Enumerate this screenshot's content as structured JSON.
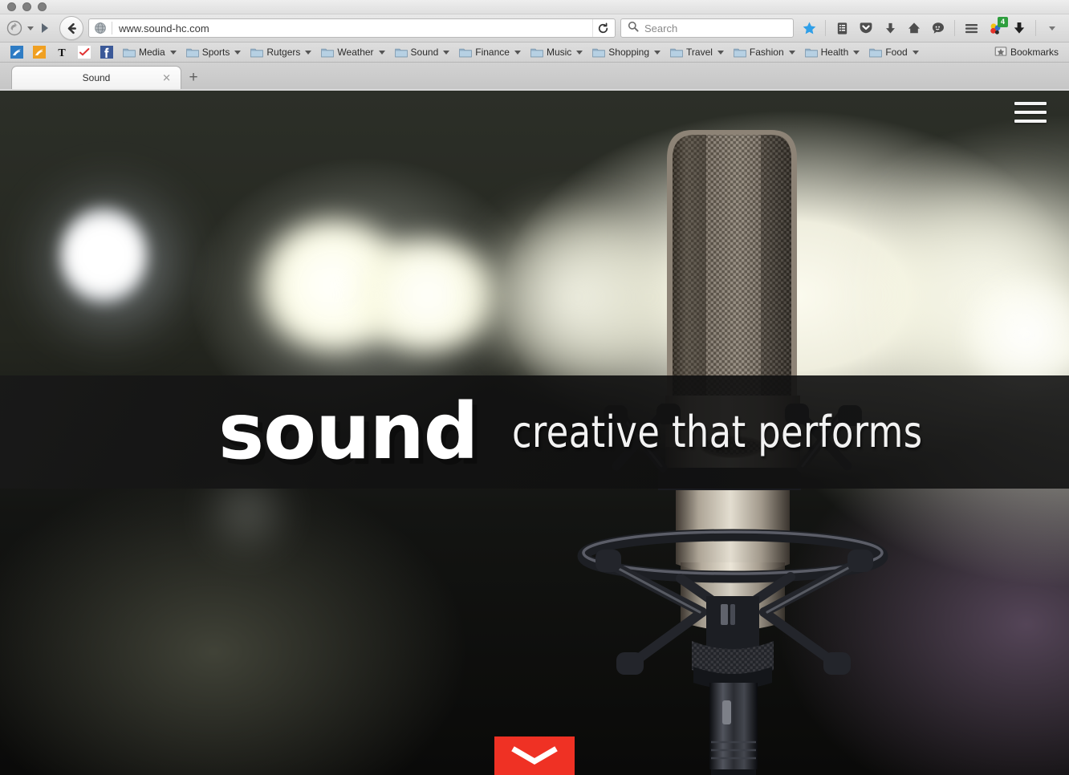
{
  "window": {
    "traffic_lights": [
      "close",
      "minimize",
      "zoom"
    ]
  },
  "toolbar": {
    "firefox_menu_label": "firefox-logo",
    "back_label": "Back",
    "forward_label": "Forward",
    "url": "www.sound-hc.com",
    "reload_label": "Reload",
    "search_placeholder": "Search",
    "icons": [
      {
        "name": "bookmark-star-icon",
        "label": "Bookmark this page"
      },
      {
        "name": "reader-list-icon",
        "label": "Reading list"
      },
      {
        "name": "pocket-icon",
        "label": "Pocket"
      },
      {
        "name": "downloads-icon",
        "label": "Downloads"
      },
      {
        "name": "home-icon",
        "label": "Home"
      },
      {
        "name": "chat-icon",
        "label": "Hello"
      },
      {
        "name": "menu-hamburger-icon",
        "label": "Open menu"
      },
      {
        "name": "extension-icon",
        "label": "Extension",
        "badge": "4"
      },
      {
        "name": "download-manager-icon",
        "label": "Download manager"
      },
      {
        "name": "overflow-caret-icon",
        "label": "More"
      }
    ],
    "extension_badge": "4"
  },
  "bookmarks_bar": {
    "items": [
      {
        "label": "",
        "icon": "site-favicon-blue",
        "type": "site"
      },
      {
        "label": "",
        "icon": "site-favicon-orange",
        "type": "site"
      },
      {
        "label": "",
        "icon": "nyt-favicon",
        "type": "site"
      },
      {
        "label": "",
        "icon": "check-favicon",
        "type": "site"
      },
      {
        "label": "",
        "icon": "facebook-favicon",
        "type": "site"
      },
      {
        "label": "Media",
        "icon": "folder-icon",
        "type": "folder"
      },
      {
        "label": "Sports",
        "icon": "folder-icon",
        "type": "folder"
      },
      {
        "label": "Rutgers",
        "icon": "folder-icon",
        "type": "folder"
      },
      {
        "label": "Weather",
        "icon": "folder-icon",
        "type": "folder"
      },
      {
        "label": "Sound",
        "icon": "folder-icon",
        "type": "folder"
      },
      {
        "label": "Finance",
        "icon": "folder-icon",
        "type": "folder"
      },
      {
        "label": "Music",
        "icon": "folder-icon",
        "type": "folder"
      },
      {
        "label": "Shopping",
        "icon": "folder-icon",
        "type": "folder"
      },
      {
        "label": "Travel",
        "icon": "folder-icon",
        "type": "folder"
      },
      {
        "label": "Fashion",
        "icon": "folder-icon",
        "type": "folder"
      },
      {
        "label": "Health",
        "icon": "folder-icon",
        "type": "folder"
      },
      {
        "label": "Food",
        "icon": "folder-icon",
        "type": "folder"
      }
    ],
    "all_bookmarks_label": "Bookmarks"
  },
  "tabs": {
    "items": [
      {
        "title": "Sound",
        "active": true,
        "close_glyph": "✕"
      }
    ],
    "new_tab_glyph": "+"
  },
  "page": {
    "hero": {
      "title": "sound",
      "subtitle": "creative that performs",
      "background_description": "close-up of a studio condenser microphone in a shock mount against blurred stage lights",
      "nav_toggle_name": "hamburger-menu",
      "scroll_button_name": "scroll-down-chevron",
      "accent_color": "#ef3124",
      "band_color": "#161616",
      "text_color": "#ffffff"
    }
  }
}
